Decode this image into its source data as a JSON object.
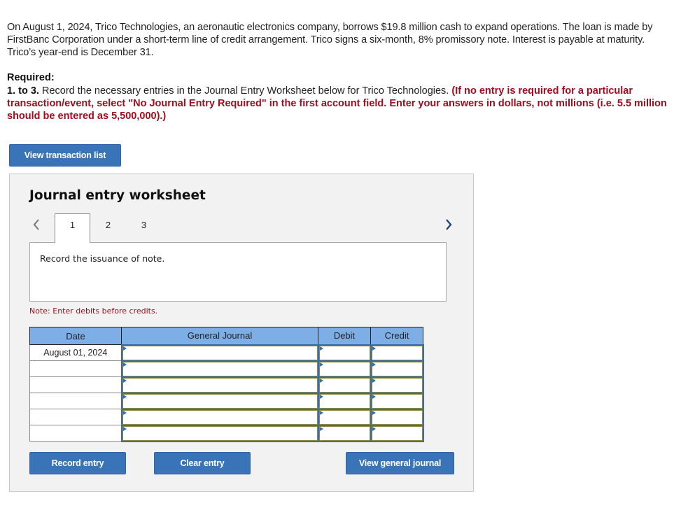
{
  "problem": {
    "intro": "On August 1, 2024, Trico Technologies, an aeronautic electronics company, borrows $19.8 million cash to expand operations. The loan is made by FirstBanc Corporation under a short-term line of credit arrangement. Trico signs a six-month, 8% promissory note. Interest is payable at maturity. Trico’s year-end is December 31.",
    "required_heading": "Required:",
    "required_number": "1. to 3.",
    "required_text": " Record the necessary entries in the Journal Entry Worksheet below for Trico Technologies. ",
    "required_instruction": "(If no entry is required for a particular transaction/event, select \"No Journal Entry Required\" in the first account field. Enter your answers in dollars, not millions (i.e. 5.5 million should be entered as 5,500,000).)"
  },
  "buttons": {
    "view_transaction_list": "View transaction list",
    "record_entry": "Record entry",
    "clear_entry": "Clear entry",
    "view_general_journal": "View general journal"
  },
  "worksheet": {
    "title": "Journal entry worksheet",
    "nav_prev_icon": "chevron-left-icon",
    "nav_next_icon": "chevron-right-icon",
    "tabs": [
      {
        "label": "1",
        "active": true
      },
      {
        "label": "2",
        "active": false
      },
      {
        "label": "3",
        "active": false
      }
    ],
    "description": "Record the issuance of note.",
    "note": "Note: Enter debits before credits.",
    "table": {
      "headers": {
        "date": "Date",
        "account": "General Journal",
        "debit": "Debit",
        "credit": "Credit"
      },
      "rows": [
        {
          "date": "August 01, 2024",
          "account": "",
          "debit": "",
          "credit": ""
        },
        {
          "date": "",
          "account": "",
          "debit": "",
          "credit": ""
        },
        {
          "date": "",
          "account": "",
          "debit": "",
          "credit": ""
        },
        {
          "date": "",
          "account": "",
          "debit": "",
          "credit": ""
        },
        {
          "date": "",
          "account": "",
          "debit": "",
          "credit": ""
        },
        {
          "date": "",
          "account": "",
          "debit": "",
          "credit": ""
        }
      ]
    }
  },
  "colors": {
    "button_blue": "#3a74b8",
    "header_blue": "#7daee6",
    "instruction_red": "#a10c1e",
    "panel_bg": "#f2f2f2"
  }
}
